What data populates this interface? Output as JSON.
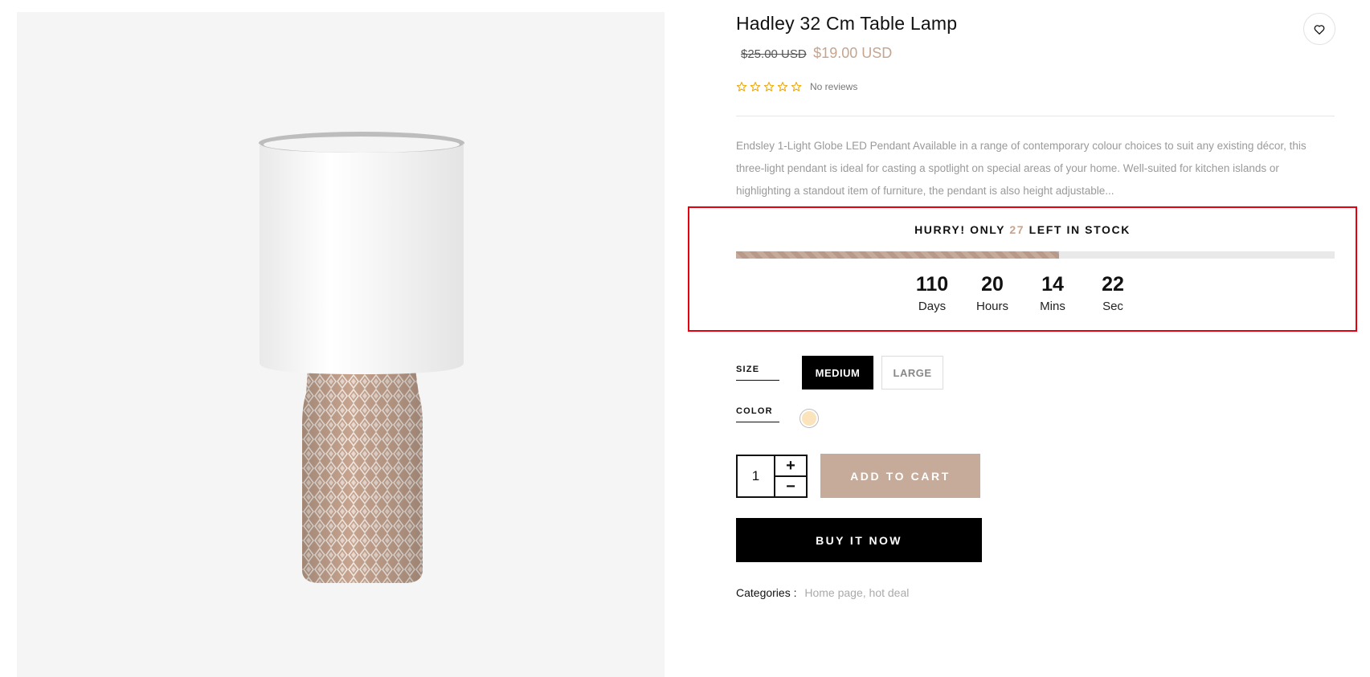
{
  "product": {
    "title": "Hadley 32 Cm Table Lamp",
    "old_price": "$25.00 USD",
    "new_price": "$19.00 USD",
    "rating": {
      "stars_filled": 0,
      "stars_total": 5,
      "reviews_text": "No reviews"
    },
    "description": "Endsley 1-Light Globe LED Pendant Available in a range of contemporary colour choices to suit any existing décor, this three-light pendant is ideal for casting a spotlight on special areas of your home. Well-suited for kitchen islands or highlighting a standout item of furniture, the pendant is also height adjustable...",
    "image_icon": "table-lamp-image"
  },
  "stock": {
    "prefix": "HURRY! ONLY ",
    "count": "27",
    "suffix": " LEFT IN STOCK",
    "progress_percent": 54
  },
  "countdown": [
    {
      "value": "110",
      "label": "Days"
    },
    {
      "value": "20",
      "label": "Hours"
    },
    {
      "value": "14",
      "label": "Mins"
    },
    {
      "value": "22",
      "label": "Sec"
    }
  ],
  "options": {
    "size_label": "SIZE",
    "sizes": [
      "MEDIUM",
      "LARGE"
    ],
    "selected_size": "MEDIUM",
    "color_label": "COLOR",
    "color_swatch": "#fbe3bb"
  },
  "cart": {
    "quantity": "1",
    "plus": "+",
    "minus": "−",
    "add_to_cart": "ADD TO CART",
    "buy_now": "BUY IT NOW"
  },
  "categories": {
    "label": "Categories :",
    "links": "Home page, hot deal"
  },
  "colors": {
    "accent": "#c6ab9b",
    "price": "#c4a590",
    "stars": "#f0a500",
    "highlight_border": "#e5000f"
  },
  "icons": {
    "wishlist": "heart-icon",
    "star": "star-outline-icon"
  }
}
